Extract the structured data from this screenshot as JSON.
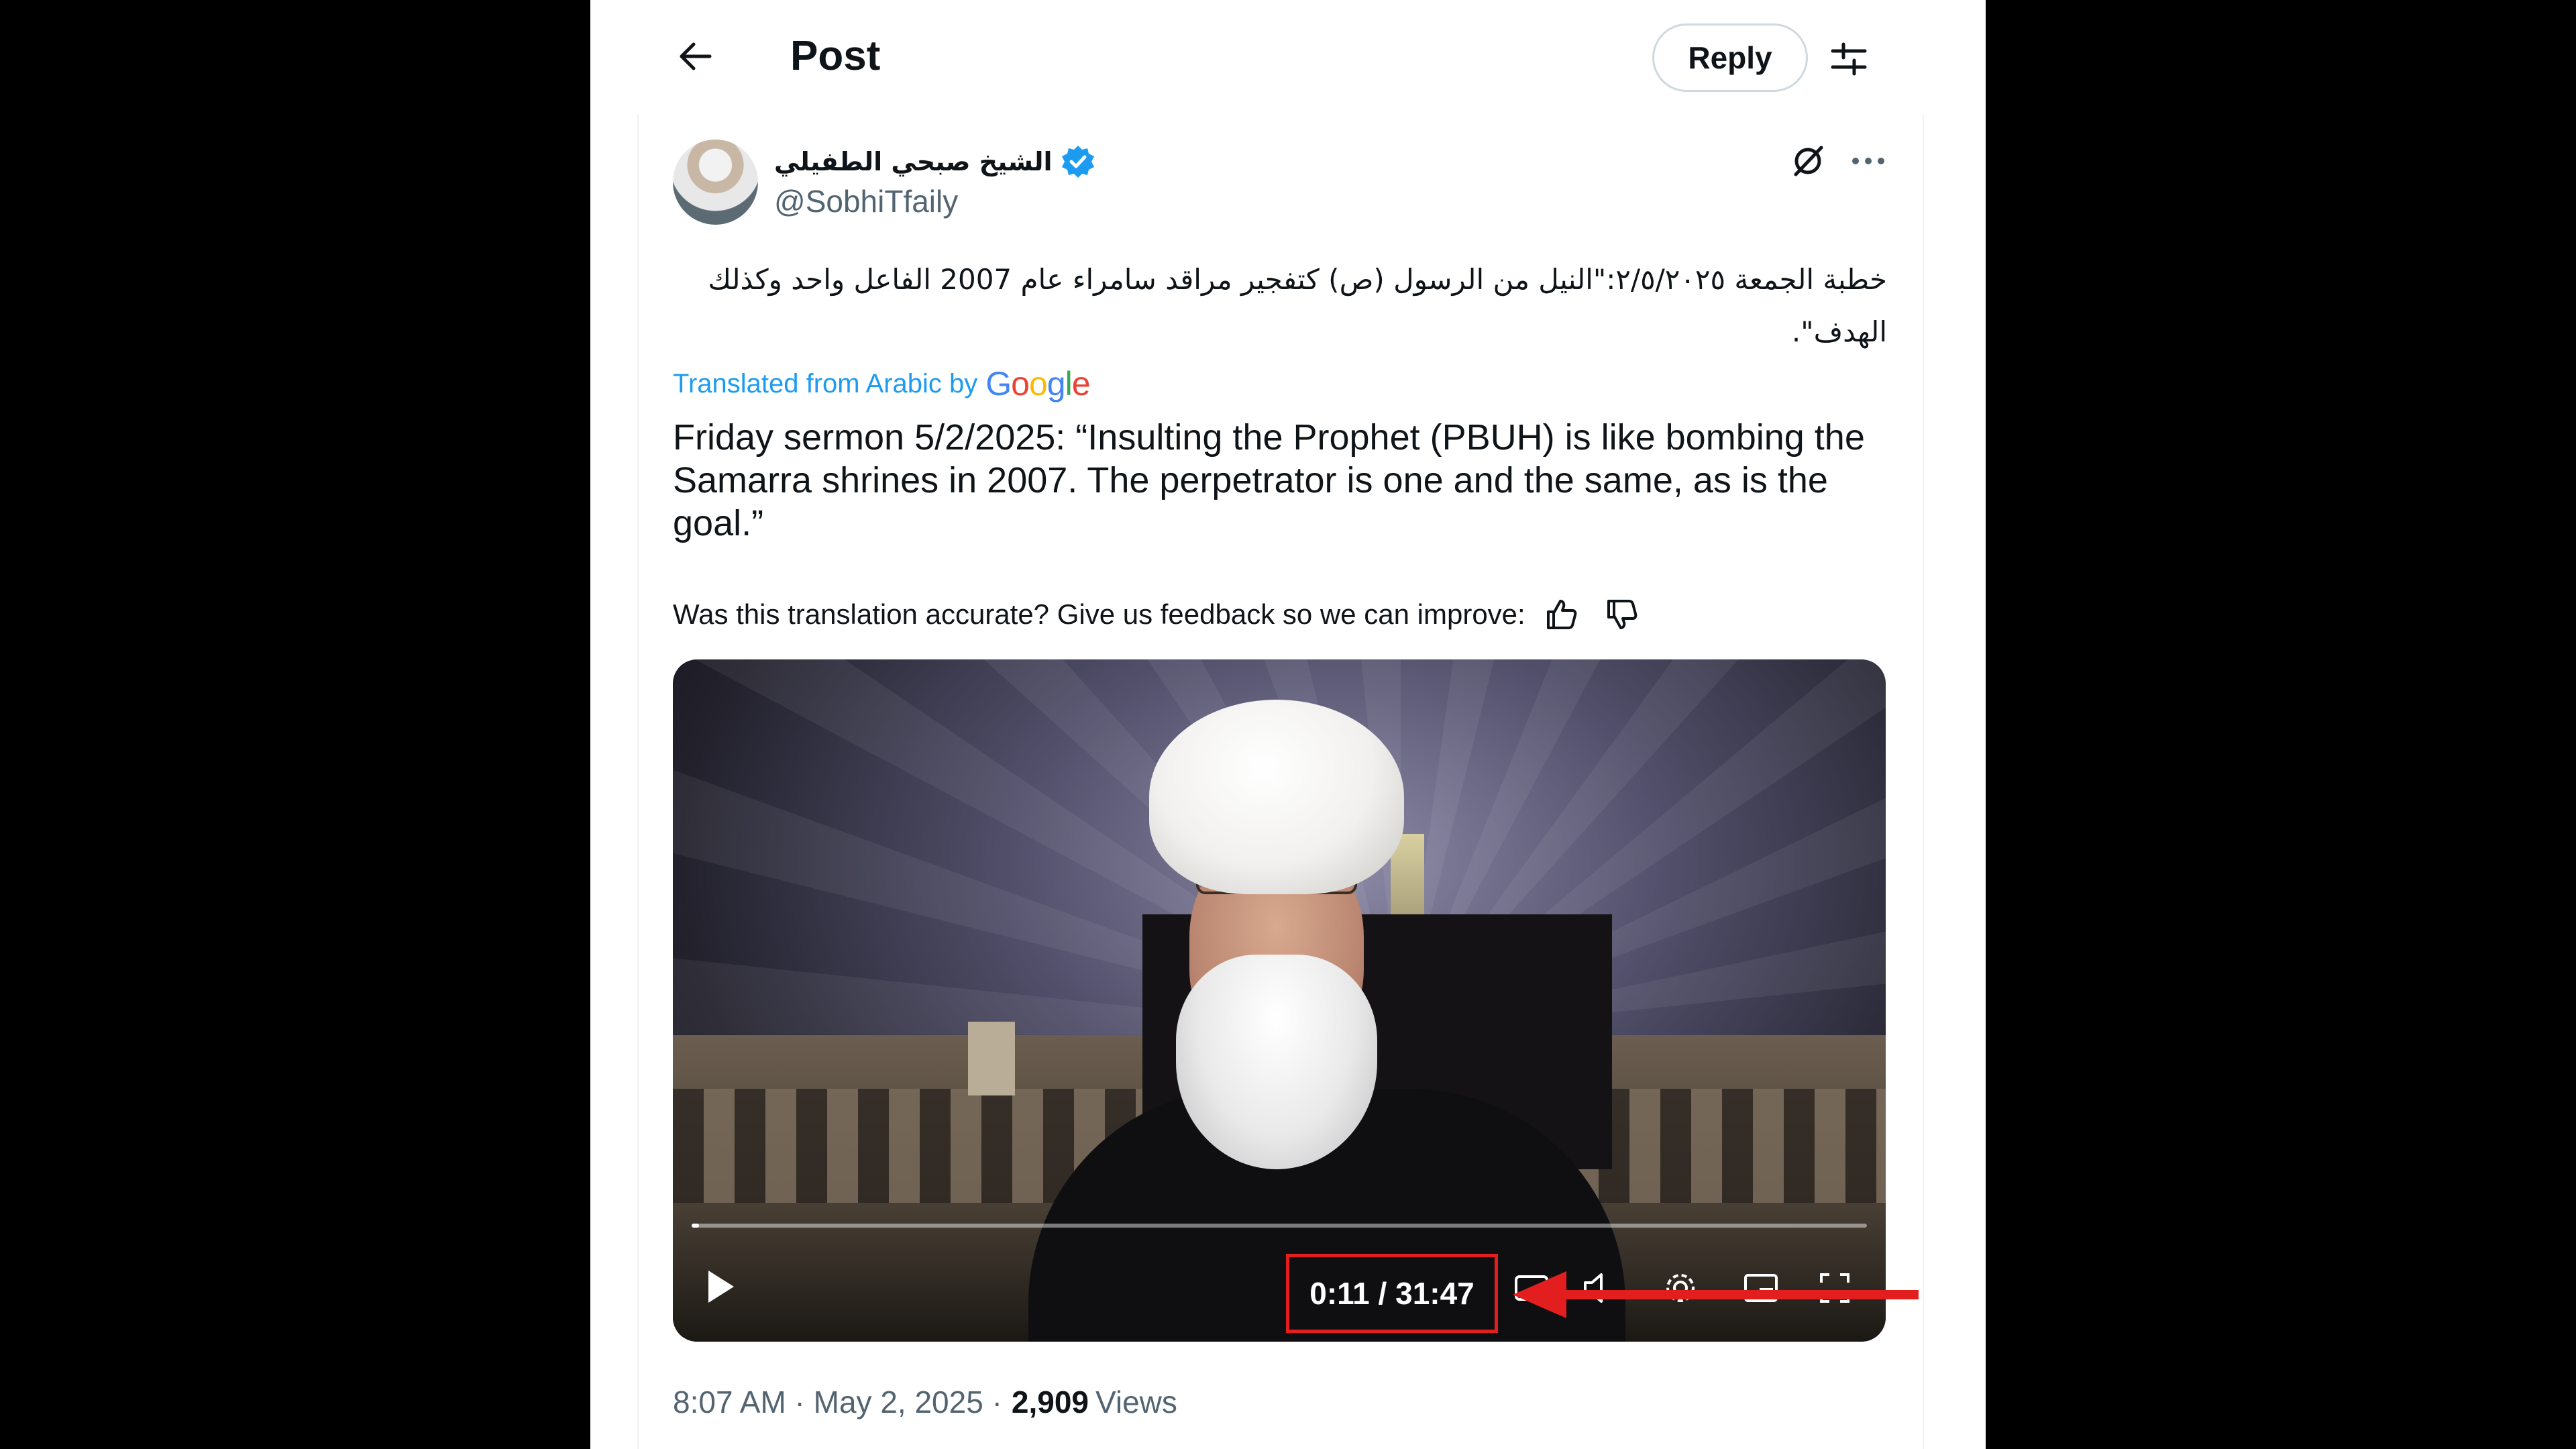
{
  "header": {
    "title": "Post",
    "reply_label": "Reply",
    "back_icon": "arrow-left-icon",
    "settings_icon": "sliders-icon"
  },
  "author": {
    "name": "الشيخ صبحي الطفيلي",
    "handle": "@SobhiTfaily",
    "verified": true,
    "verified_color": "#1d9bf0"
  },
  "post": {
    "arabic_line1": "خطبة الجمعة ٢/٥/٢٠٢٥:\"النيل من الرسول (ص) كتفجير مراقد سامراء عام 2007 الفاعل واحد وكذلك",
    "arabic_line2": "الهدف\".",
    "translated_from": "Translated from Arabic by",
    "google": "Google",
    "translation": "Friday sermon 5/2/2025: “Insulting the Prophet (PBUH) is like bombing the Samarra shrines in 2007. The perpetrator is one and the same, as is the goal.”",
    "feedback_prompt": "Was this translation accurate? Give us feedback so we can improve:"
  },
  "video": {
    "time_display": "0:11 / 31:47",
    "progress_fraction": 0.006
  },
  "meta": {
    "time": "8:07 AM · May 2, 2025 ·",
    "views_count": "2,909",
    "views_label": "Views"
  },
  "colors": {
    "accent": "#1d9bf0",
    "annotation_red": "#e31e1e"
  }
}
